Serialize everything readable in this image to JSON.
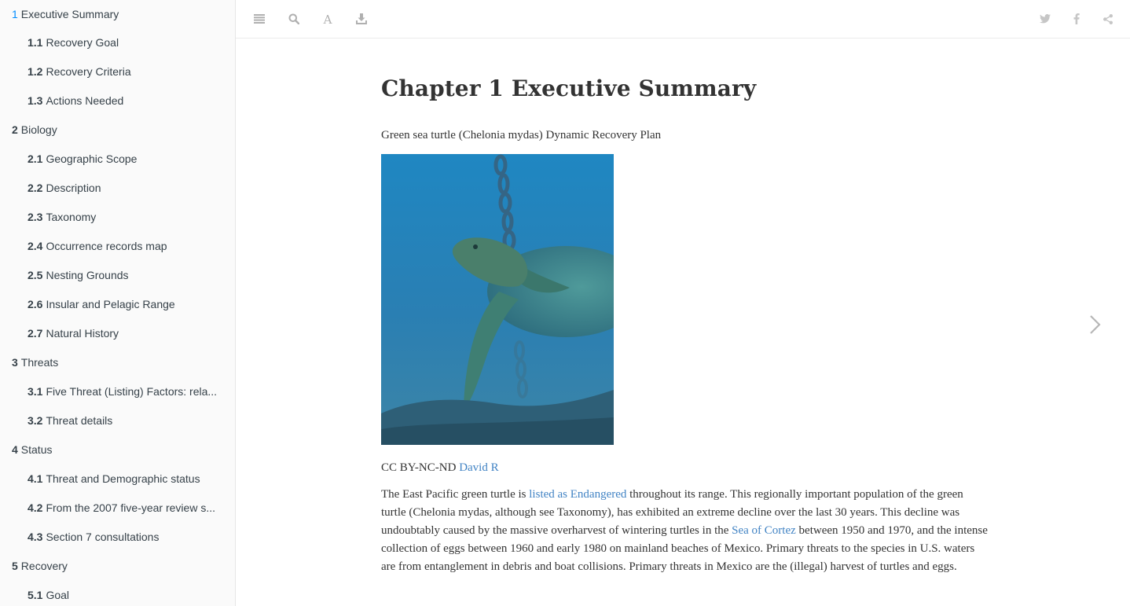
{
  "sidebar": {
    "items": [
      {
        "num": "1",
        "label": "Executive Summary",
        "level": 1,
        "active": true
      },
      {
        "num": "1.1",
        "label": "Recovery Goal",
        "level": 2
      },
      {
        "num": "1.2",
        "label": "Recovery Criteria",
        "level": 2
      },
      {
        "num": "1.3",
        "label": "Actions Needed",
        "level": 2
      },
      {
        "num": "2",
        "label": "Biology",
        "level": 1
      },
      {
        "num": "2.1",
        "label": "Geographic Scope",
        "level": 2
      },
      {
        "num": "2.2",
        "label": "Description",
        "level": 2
      },
      {
        "num": "2.3",
        "label": "Taxonomy",
        "level": 2
      },
      {
        "num": "2.4",
        "label": "Occurrence records map",
        "level": 2
      },
      {
        "num": "2.5",
        "label": "Nesting Grounds",
        "level": 2
      },
      {
        "num": "2.6",
        "label": "Insular and Pelagic Range",
        "level": 2
      },
      {
        "num": "2.7",
        "label": "Natural History",
        "level": 2
      },
      {
        "num": "3",
        "label": "Threats",
        "level": 1
      },
      {
        "num": "3.1",
        "label": "Five Threat (Listing) Factors: rela...",
        "level": 2
      },
      {
        "num": "3.2",
        "label": "Threat details",
        "level": 2
      },
      {
        "num": "4",
        "label": "Status",
        "level": 1
      },
      {
        "num": "4.1",
        "label": "Threat and Demographic status",
        "level": 2
      },
      {
        "num": "4.2",
        "label": "From the 2007 five-year review s...",
        "level": 2
      },
      {
        "num": "4.3",
        "label": "Section 7 consultations",
        "level": 2
      },
      {
        "num": "5",
        "label": "Recovery",
        "level": 1
      },
      {
        "num": "5.1",
        "label": "Goal",
        "level": 2
      }
    ]
  },
  "toolbar": {
    "left_icons": [
      "menu-icon",
      "search-icon",
      "font-settings-icon",
      "download-icon"
    ],
    "right_icons": [
      "twitter-icon",
      "facebook-icon",
      "share-icon"
    ]
  },
  "main": {
    "title": "Chapter 1 Executive Summary",
    "subtitle": "Green sea turtle (Chelonia mydas) Dynamic Recovery Plan",
    "credit_prefix": "CC BY-NC-ND",
    "credit_link": "David R",
    "para_1": "The East Pacific green turtle is",
    "para_link_1": "listed as Endangered",
    "para_2": "throughout its range. This regionally important population of the green turtle (Chelonia mydas, although see Taxonomy), has exhibited an extreme decline over the last 30 years. This decline was undoubtably caused by the massive overharvest of wintering turtles in the",
    "para_link_2": "Sea of Cortez",
    "para_3": "between 1950 and 1970, and the intense collection of eggs between 1960 and early 1980 on mainland beaches of Mexico. Primary threats to the species in U.S. waters are from entanglement in debris and boat collisions. Primary threats in Mexico are the (illegal) harvest of turtles and eggs."
  },
  "colors": {
    "link": "#4183c4",
    "active_number": "#008cff",
    "sidebar_bg": "#fafafa",
    "icon": "#b0b0b0"
  }
}
